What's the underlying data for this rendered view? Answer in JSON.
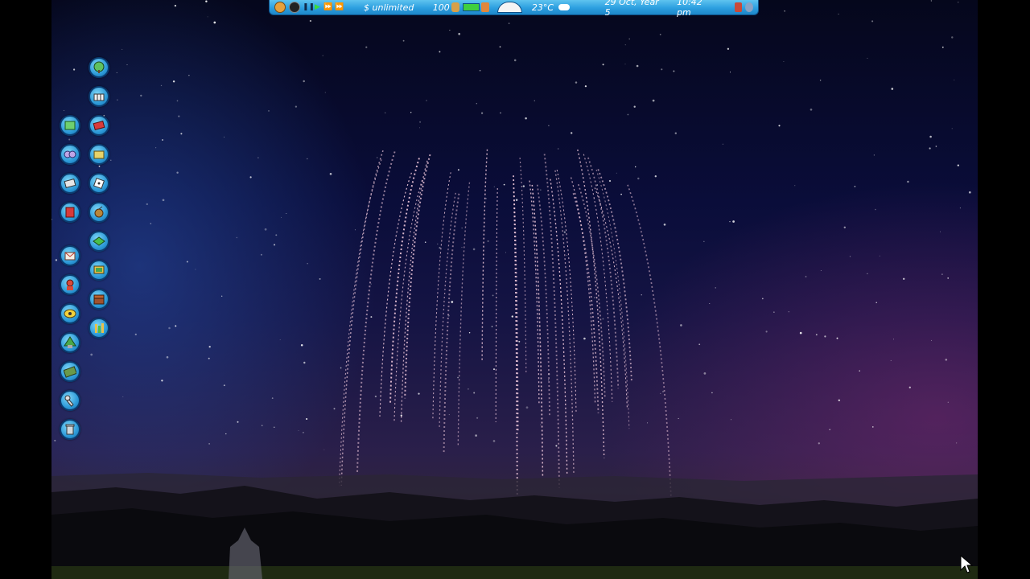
{
  "topbar": {
    "money": "$ unlimited",
    "park_rating": "100",
    "temperature": "23°C",
    "date": "29 Oct, Year 5",
    "time": "10:42 pm",
    "speed_controls": [
      "pause",
      "play",
      "fast",
      "fastest"
    ],
    "weather_icon": "cloud-icon"
  },
  "toolbar_left_column": [
    "terrain-landscape-icon",
    "scenery-icon",
    "paths-icon",
    "rides-icon",
    "shops-icon",
    "staff-icon",
    "guests-icon",
    "finance-icon",
    "park-info-icon",
    "demolish-icon"
  ],
  "toolbar_right_column": [
    "trees-icon",
    "fences-icon",
    "walls-icon",
    "stalls-icon",
    "animals-icon",
    "fireworks-icon",
    "terrain-icon",
    "sign-icon",
    "chest-icon",
    "pool-icon"
  ],
  "colors": {
    "topbar": "#2c9fe0",
    "button": "#2d9ad8",
    "sky_top": "#05071c",
    "sky_horizon": "#2a1f4a"
  }
}
